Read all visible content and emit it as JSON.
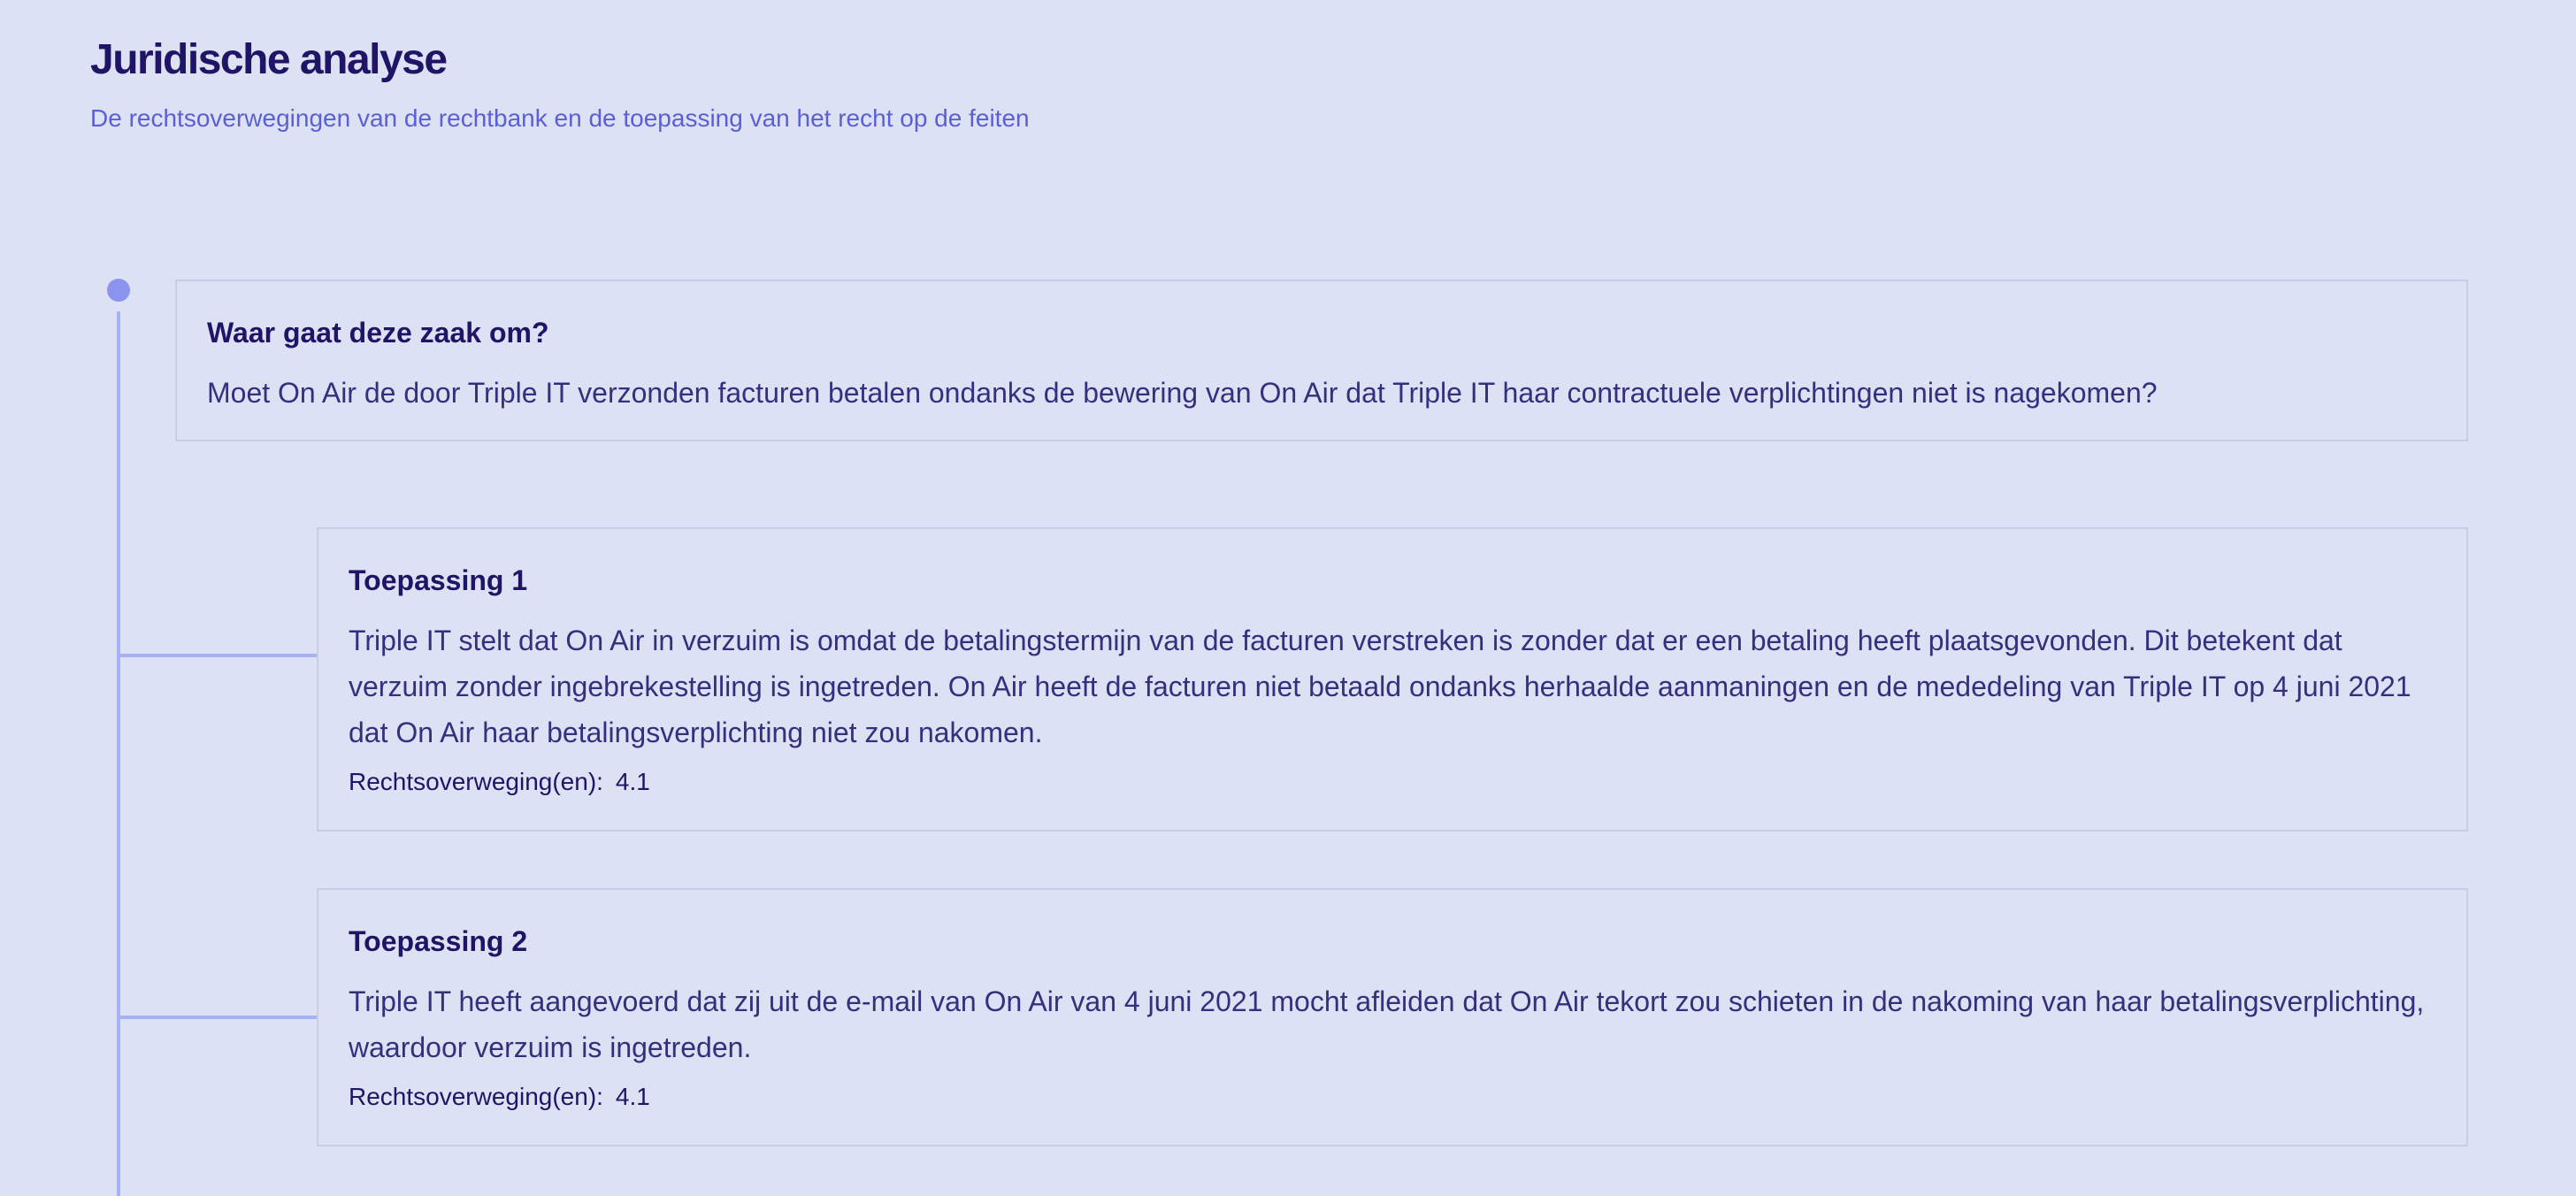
{
  "header": {
    "title": "Juridische analyse",
    "subtitle": "De rechtsoverwegingen van de rechtbank en de toepassing van het recht op de feiten"
  },
  "question": {
    "title": "Waar gaat deze zaak om?",
    "text": "Moet On Air de door Triple IT verzonden facturen betalen ondanks de bewering van On Air dat Triple IT haar contractuele verplichtingen niet is nagekomen?"
  },
  "applications": [
    {
      "title": "Toepassing 1",
      "text": "Triple IT stelt dat On Air in verzuim is omdat de betalingstermijn van de facturen verstreken is zonder dat er een betaling heeft plaatsgevonden. Dit betekent dat verzuim zonder ingebrekestelling is ingetreden. On Air heeft de facturen niet betaald ondanks herhaalde aanmaningen en de mededeling van Triple IT op 4 juni 2021 dat On Air haar betalingsverplichting niet zou nakomen.",
      "ref_label": "Rechtsoverweging(en):",
      "ref_value": "4.1"
    },
    {
      "title": "Toepassing 2",
      "text": "Triple IT heeft aangevoerd dat zij uit de e-mail van On Air van 4 juni 2021 mocht afleiden dat On Air tekort zou schieten in de nakoming van haar betalingsverplichting, waardoor verzuim is ingetreden.",
      "ref_label": "Rechtsoverweging(en):",
      "ref_value": "4.1"
    }
  ],
  "colors": {
    "background": "#dde1f4",
    "title": "#1f1466",
    "subtitle": "#5b5fd6",
    "timeline": "#a9b1f5",
    "dot": "#8a93ee",
    "card_border": "#c8cce8"
  }
}
